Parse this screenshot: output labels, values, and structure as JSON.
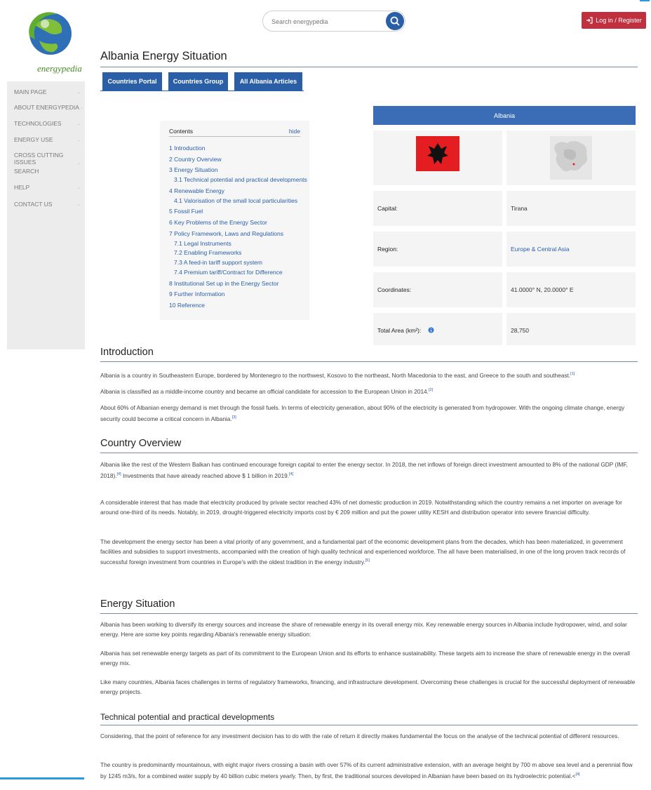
{
  "header": {
    "logo_text": "energypedia",
    "search_placeholder": "Search energypedia",
    "login_label": "Log in / Register"
  },
  "sidebar": {
    "items": [
      {
        "label": "MAIN PAGE"
      },
      {
        "label": "ABOUT ENERGYPEDIA"
      },
      {
        "label": "TECHNOLOGIES"
      },
      {
        "label": "ENERGY USE"
      },
      {
        "label": "CROSS CUTTING ISSUES"
      },
      {
        "label": "SEARCH"
      },
      {
        "label": "HELP"
      },
      {
        "label": "CONTACT US"
      }
    ]
  },
  "page": {
    "title": "Albania Energy Situation",
    "tabs": [
      {
        "label": "Countries Portal"
      },
      {
        "label": "Countries Group"
      },
      {
        "label": "All Albania Articles"
      }
    ]
  },
  "toc": {
    "title": "Contents",
    "hide_label": "hide",
    "items": [
      {
        "label": "1 Introduction"
      },
      {
        "label": "2 Country Overview"
      },
      {
        "label": "3 Energy Situation"
      },
      {
        "label": "3.1 Technical potential and practical developments"
      },
      {
        "label": "4 Renewable Energy"
      },
      {
        "label": "4.1 Valorisation of the small local particularities"
      },
      {
        "label": "5 Fossil Fuel"
      },
      {
        "label": "6 Key Problems of the Energy Sector"
      },
      {
        "label": "7 Policy Framework, Laws and Regulations"
      },
      {
        "label": "7.1 Legal Instruments"
      },
      {
        "label": "7.2 Enabling Frameworks"
      },
      {
        "label": "7.3 A feed-in tariff support system"
      },
      {
        "label": "7.4 Premium tariff/Contract for Difference"
      },
      {
        "label": "8 Institutional Set up in the Energy Sector"
      },
      {
        "label": "9 Further Information"
      },
      {
        "label": "10 Reference"
      }
    ]
  },
  "infobox": {
    "country": "Albania",
    "capital_label": "Capital:",
    "capital_value": "Tirana",
    "region_label": "Region:",
    "region_value": "Europe & Central Asia",
    "coords_label": "Coordinates:",
    "coords_value": "41.0000° N, 20.0000° E",
    "area_label": "Total Area (km²):",
    "area_value": "28,750",
    "flag_color": "#e41e20"
  },
  "article": {
    "intro_heading": "Introduction",
    "intro_p1": "Albania is a country in Southeastern Europe, bordered by Montenegro to the northwest, Kosovo to the northeast, North Macedonia to the east, and Greece to the south and southeast.",
    "intro_p1_ref": "[1]",
    "intro_p2": "Albania is classified as a middle-income country and became an official candidate for accession to the European Union in 2014.",
    "intro_p2_ref": "[2]",
    "intro_p3": "About 60% of Albanian energy demand is met through the fossil fuels. In terms of electricity generation, about 90% of the electricity is generated from hydropower. With the ongoing climate change, energy security could become a critical concern in Albania.",
    "intro_p3_ref": "[3]",
    "overview_heading": "Country Overview",
    "overview_p1a": "Albania like the rest of the Western Balkan has continued encourage foreign capital to enter the energy sector. In 2018, the net inflows of foreign direct investment amounted to 8% of the national GDP (IMF, 2018).",
    "overview_p1_ref1": "[4]",
    "overview_p1b": " Investments that have already reached above $ 1 billion in 2019.",
    "overview_p1_ref2": "[4]",
    "overview_p2": "A considerable interest that has made that electricity produced by private sector reached 43% of net domestic production in 2019. Notwithstanding which the country remains a net importer on average for around one-third of its needs. Notably, in 2019, drought-triggered electricity imports cost by € 209 million and put the power utility KESH and distribution operator into severe financial difficulty.",
    "overview_p3": "The development the energy sector has been a vital priority of any government, and a fundamental part of the economic development plans from the decades, which has been materialized, in government facilities and subsidies to support investments, accompanied with the creation of high quality technical and experienced workforce. The all have been materialised, in one of the long proven track records of successful foreign investment from countries in Europe's with the oldest tradition in the energy industry.",
    "overview_p3_ref": "[5]",
    "energy_heading": "Energy Situation",
    "energy_p1": "Albania has been working to diversify its energy sources and increase the share of renewable energy in its overall energy mix. Key renewable energy sources in Albania include hydropower, wind, and solar energy. Here are some key points regarding Albania's renewable energy situation:",
    "energy_p2": "Albania has set renewable energy targets as part of its commitment to the European Union and its efforts to enhance sustainability. These targets aim to increase the share of renewable energy in the overall energy mix.",
    "energy_p3": "Like many countries, Albania faces challenges in terms of regulatory frameworks, financing, and infrastructure development. Overcoming these challenges is crucial for the successful deployment of renewable energy projects.",
    "tech_heading": "Technical potential and practical developments",
    "tech_p1": "Considering, that the point of reference for any investment decision has to do with the rate of return it directly makes fundamental the focus on the analyse of the technical potential of different resources.",
    "tech_p2": "The country is predominantly mountainous, with eight major rivers crossing a basin with over 57% of its current administrative extension, with an average height by 700 m above sea level and a perennial flow by 1245 m3/s, for a combined water supply by 40 billion cubic meters yearly. Then, by first, the traditional sources developed in Albanian have been based on its hydroelectric potential.<",
    "tech_p2_ref": "[4]"
  }
}
